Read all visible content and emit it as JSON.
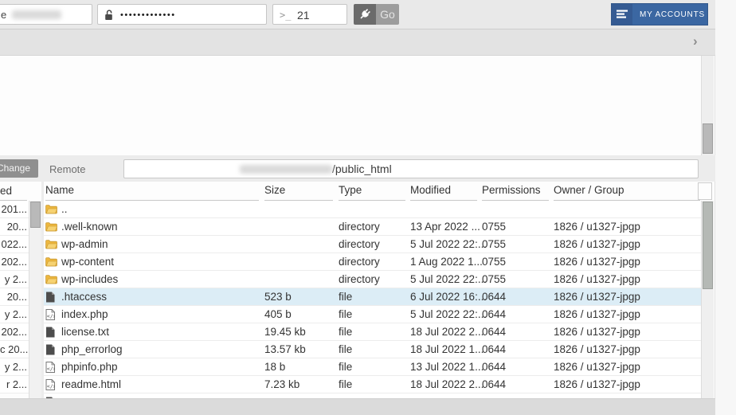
{
  "topbar": {
    "host_fragment": "e",
    "password_mask": "•••••••••••••",
    "port_prompt": ">_",
    "port_value": "21",
    "go_label": "Go",
    "my_accounts_label": "MY ACCOUNTS"
  },
  "toolbar_band": {
    "chevron": "›"
  },
  "remote_bar": {
    "change_label": "Change",
    "remote_label": "Remote",
    "path_visible_suffix": "/public_html"
  },
  "local_panel": {
    "header_fragment": "ed",
    "row_fragments": [
      "201...",
      "20...",
      "022...",
      "202...",
      "y 2...",
      "20...",
      "y 2...",
      "202...",
      "c 20...",
      "y 2...",
      "r 2..."
    ]
  },
  "file_table": {
    "headers": [
      "Name",
      "Size",
      "Type",
      "Modified",
      "Permissions",
      "Owner / Group"
    ],
    "rows": [
      {
        "icon": "folder-icon",
        "name": "..",
        "size": "",
        "type": "",
        "modified": "",
        "permissions": "",
        "owner": "",
        "selected": false
      },
      {
        "icon": "folder-icon",
        "name": ".well-known",
        "size": "",
        "type": "directory",
        "modified": "13 Apr 2022 ...",
        "permissions": "0755",
        "owner": "1826 / u1327-jpgp",
        "selected": false
      },
      {
        "icon": "folder-icon",
        "name": "wp-admin",
        "size": "",
        "type": "directory",
        "modified": "5 Jul 2022 22:...",
        "permissions": "0755",
        "owner": "1826 / u1327-jpgp",
        "selected": false
      },
      {
        "icon": "folder-icon",
        "name": "wp-content",
        "size": "",
        "type": "directory",
        "modified": "1 Aug 2022 1...",
        "permissions": "0755",
        "owner": "1826 / u1327-jpgp",
        "selected": false
      },
      {
        "icon": "folder-icon",
        "name": "wp-includes",
        "size": "",
        "type": "directory",
        "modified": "5 Jul 2022 22:...",
        "permissions": "0755",
        "owner": "1826 / u1327-jpgp",
        "selected": false
      },
      {
        "icon": "file-dark-icon",
        "name": ".htaccess",
        "size": "523 b",
        "type": "file",
        "modified": "6 Jul 2022 16:...",
        "permissions": "0644",
        "owner": "1826 / u1327-jpgp",
        "selected": true
      },
      {
        "icon": "file-code-icon",
        "name": "index.php",
        "size": "405 b",
        "type": "file",
        "modified": "5 Jul 2022 22:...",
        "permissions": "0644",
        "owner": "1826 / u1327-jpgp",
        "selected": false
      },
      {
        "icon": "file-dark-icon",
        "name": "license.txt",
        "size": "19.45 kb",
        "type": "file",
        "modified": "18 Jul 2022 2...",
        "permissions": "0644",
        "owner": "1826 / u1327-jpgp",
        "selected": false
      },
      {
        "icon": "file-dark-icon",
        "name": "php_errorlog",
        "size": "13.57 kb",
        "type": "file",
        "modified": "18 Jul 2022 1...",
        "permissions": "0644",
        "owner": "1826 / u1327-jpgp",
        "selected": false
      },
      {
        "icon": "file-code-icon",
        "name": "phpinfo.php",
        "size": "18 b",
        "type": "file",
        "modified": "13 Jul 2022 1...",
        "permissions": "0644",
        "owner": "1826 / u1327-jpgp",
        "selected": false
      },
      {
        "icon": "file-code-icon",
        "name": "readme.html",
        "size": "7.23 kb",
        "type": "file",
        "modified": "18 Jul 2022 2...",
        "permissions": "0644",
        "owner": "1826 / u1327-jpgp",
        "selected": false
      },
      {
        "icon": "file-dark-icon",
        "name": "",
        "size": "",
        "type": "",
        "modified": "",
        "permissions": "",
        "owner": "",
        "selected": false
      }
    ]
  },
  "colors": {
    "accent_blue": "#3b67a2",
    "selection_blue": "#dcedf6",
    "folder_yellow": "#edb73f"
  }
}
